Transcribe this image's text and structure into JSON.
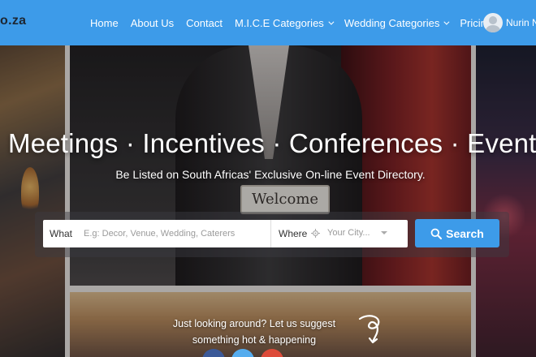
{
  "nav": {
    "logo": "o.za",
    "items": [
      {
        "label": "Home",
        "dropdown": false
      },
      {
        "label": "About Us",
        "dropdown": false
      },
      {
        "label": "Contact",
        "dropdown": false
      },
      {
        "label": "M.I.C.E Categories",
        "dropdown": true
      },
      {
        "label": "Wedding Categories",
        "dropdown": true
      },
      {
        "label": "Pricing",
        "dropdown": false
      }
    ],
    "user_name": "Nurin N"
  },
  "hero": {
    "sign_text": "Welcome",
    "title": "Meetings · Incentives · Conferences · Events",
    "subtitle": "Be Listed on South Africas' Exclusive On-line Event Directory."
  },
  "search": {
    "what_label": "What",
    "what_placeholder": "E.g: Decor, Venue, Wedding, Caterers",
    "where_label": "Where",
    "where_value": "Your City...",
    "button_label": "Search"
  },
  "suggest": {
    "line1": "Just looking around? Let us suggest",
    "line2": "something hot & happening"
  },
  "colors": {
    "primary": "#3d9be9",
    "nav_text": "#ffffff",
    "logo": "#1d2733"
  },
  "icons": [
    "user-avatar-icon",
    "location-icon",
    "search-icon",
    "swirl-arrow-icon"
  ]
}
